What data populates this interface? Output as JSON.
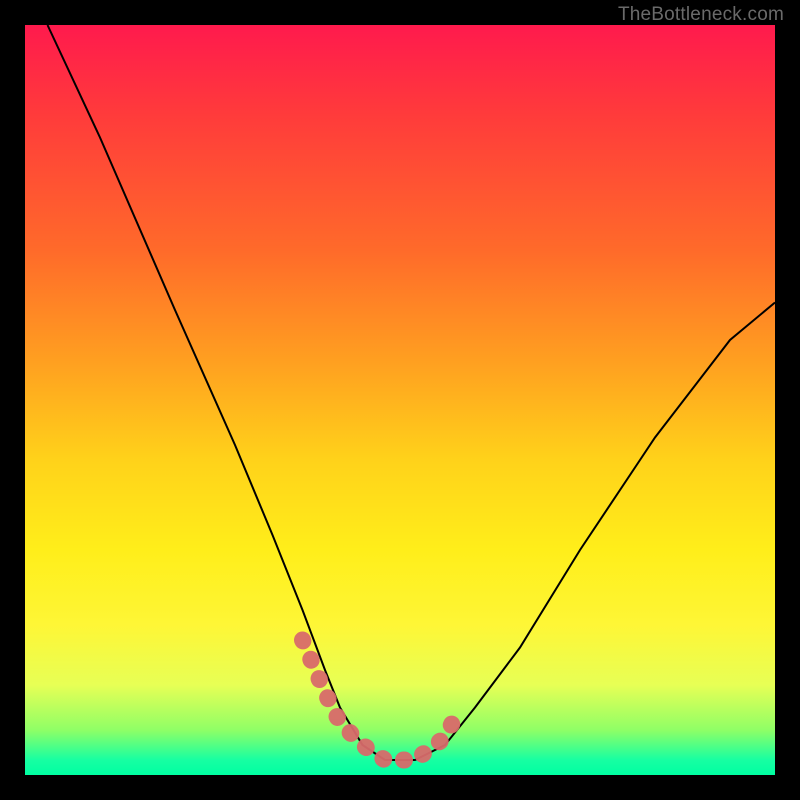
{
  "watermark": "TheBottleneck.com",
  "colors": {
    "background": "#000000",
    "gradient_top": "#ff1a4d",
    "gradient_mid": "#ffd21a",
    "gradient_bottom": "#00ffa2",
    "curve": "#000000",
    "valley_highlight": "#d86a6a"
  },
  "chart_data": {
    "type": "line",
    "title": "",
    "xlabel": "",
    "ylabel": "",
    "xlim": [
      0,
      100
    ],
    "ylim": [
      0,
      100
    ],
    "note": "No tick labels or axes are rendered. Values are estimated from pixel positions. x runs left→right, y runs bottom→top (0 at bottom).",
    "series": [
      {
        "name": "bottleneck-curve",
        "x": [
          3,
          10,
          20,
          28,
          33,
          37,
          40,
          42,
          45,
          48,
          52,
          56,
          60,
          66,
          74,
          84,
          94,
          100
        ],
        "y": [
          100,
          85,
          62,
          44,
          32,
          22,
          14,
          9,
          4,
          2,
          2,
          4,
          9,
          17,
          30,
          45,
          58,
          63
        ]
      }
    ],
    "annotations": [
      {
        "name": "valley-highlight",
        "style": "thick-salmon-dotted",
        "x": [
          37,
          40,
          42,
          45,
          48,
          52,
          56,
          58
        ],
        "y": [
          18,
          11,
          7,
          4,
          2,
          2,
          5,
          9
        ]
      }
    ]
  }
}
